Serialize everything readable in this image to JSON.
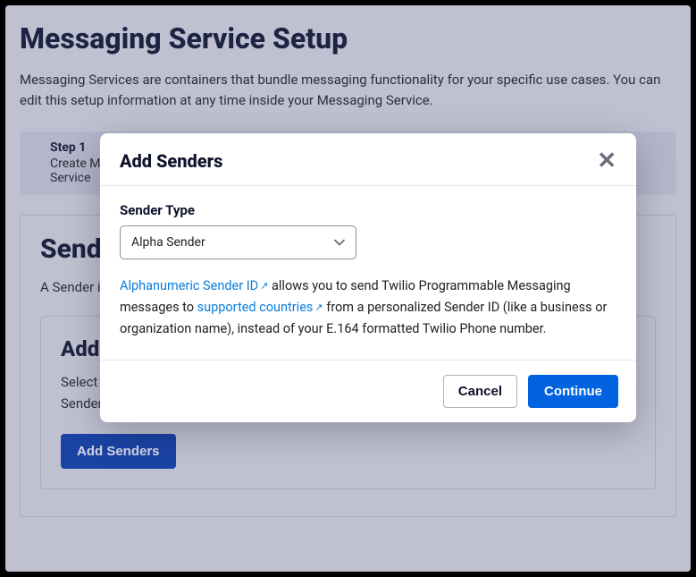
{
  "page": {
    "title": "Messaging Service Setup",
    "description": "Messaging Services are containers that bundle messaging functionality for your specific use cases. You can edit this setup information at any time inside your Messaging Service."
  },
  "steps": {
    "step1_label": "Step 1",
    "step1_sub": "Create Messaging Service"
  },
  "senderPool": {
    "title": "Sender Pool",
    "description": "A Sender is a phone number bound to this Messaging Service using the best Sender available.",
    "add_title": "Add Senders",
    "add_desc": "Select from multiple Senders like phone numbers, WhatsApp Numbers and others. Use multiple Senders for one application or use case.",
    "add_button": "Add Senders"
  },
  "modal": {
    "title": "Add Senders",
    "label_sender_type": "Sender Type",
    "selected_value": "Alpha Sender",
    "help_link1": "Alphanumeric Sender ID",
    "help_mid1": "allows you to send Twilio Programmable Messaging messages to ",
    "help_link2": "supported countries",
    "help_mid2": "from a personalized Sender ID (like a business or organization name), instead of your E.164 formatted Twilio Phone number.",
    "cancel": "Cancel",
    "continue": "Continue"
  }
}
